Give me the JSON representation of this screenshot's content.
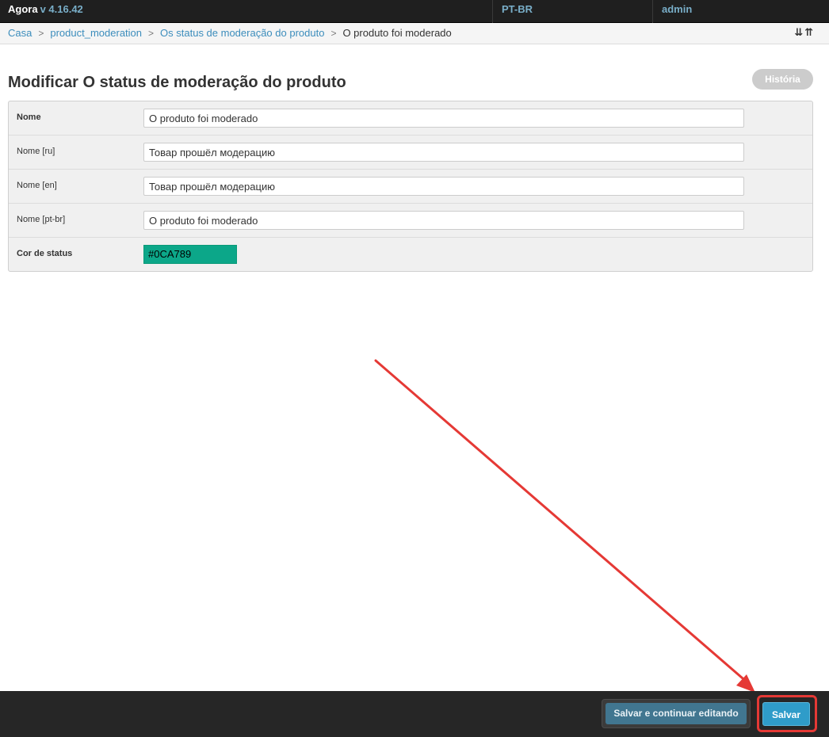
{
  "header": {
    "brand": "Agora",
    "version": "v 4.16.42",
    "language": "PT-BR",
    "user": "admin"
  },
  "breadcrumbs": {
    "items": [
      "Casa",
      "product_moderation",
      "Os status de moderação do produto"
    ],
    "current": "O produto foi moderado",
    "toggle_icons": "⇊⇈"
  },
  "page": {
    "title": "Modificar O status de moderação do produto",
    "history_label": "História"
  },
  "form": {
    "fields": [
      {
        "label": "Nome",
        "value": "O produto foi moderado"
      },
      {
        "label": "Nome [ru]",
        "value": "Товар прошёл модерацию"
      },
      {
        "label": "Nome [en]",
        "value": "Товар прошёл модерацию"
      },
      {
        "label": "Nome [pt-br]",
        "value": "O produto foi moderado"
      }
    ],
    "status_color": {
      "label": "Cor de status",
      "value": "#0CA789"
    }
  },
  "actions": {
    "save_continue_label": "Salvar e continuar editando",
    "save_label": "Salvar"
  },
  "colors": {
    "accent": "#3c8dbc",
    "annotation": "#e53935",
    "status": "#0CA789"
  }
}
